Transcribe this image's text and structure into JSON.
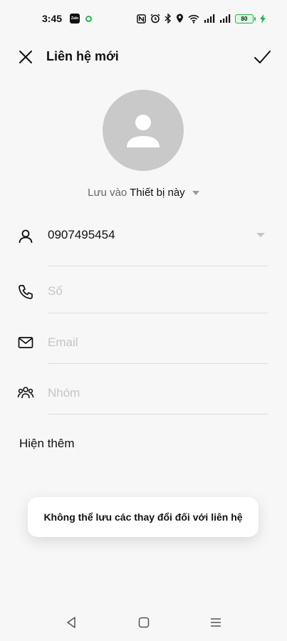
{
  "status_bar": {
    "time": "3:45",
    "app_icon": "Zalo",
    "battery": "80",
    "icons": [
      "zalo-icon",
      "green-dot-icon",
      "nfc-icon",
      "alarm-icon",
      "bluetooth-icon",
      "location-icon",
      "wifi-icon",
      "signal-icon",
      "signal-icon-2",
      "battery-icon",
      "charging-icon"
    ]
  },
  "header": {
    "title": "Liên hệ mới",
    "close_icon": "close-icon",
    "save_icon": "checkmark-icon"
  },
  "avatar": {
    "icon": "person-avatar-icon"
  },
  "save_to": {
    "label": "Lưu vào",
    "device": "Thiết bị này"
  },
  "fields": {
    "name": {
      "value": "0907495454",
      "icon": "person-icon"
    },
    "phone": {
      "placeholder": "Số",
      "icon": "phone-icon"
    },
    "email": {
      "placeholder": "Email",
      "icon": "mail-icon"
    },
    "group": {
      "placeholder": "Nhóm",
      "icon": "group-icon"
    }
  },
  "show_more": "Hiện thêm",
  "toast": "Không thể lưu các thay đổi đối với liên hệ",
  "navbar": {
    "back": "back-icon",
    "home": "home-icon",
    "menu": "menu-icon"
  },
  "colors": {
    "background": "#f7f7f7",
    "avatar": "#c9c9c9",
    "battery": "#1fb94c"
  }
}
